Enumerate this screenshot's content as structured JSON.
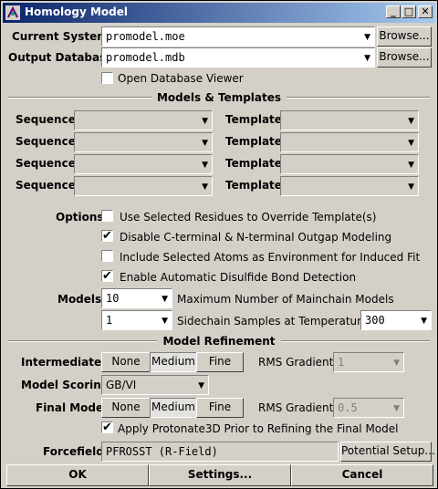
{
  "window": {
    "title": "Homology Model",
    "minimize": "_",
    "maximize": "□",
    "close": "✕"
  },
  "current_system": {
    "label": "Current System:",
    "value": "promodel.moe",
    "browse": "Browse..."
  },
  "output_database": {
    "label": "Output Database:",
    "value": "promodel.mdb",
    "browse": "Browse..."
  },
  "open_viewer": {
    "label": "Open Database Viewer",
    "checked": false
  },
  "models_templates": {
    "title": "Models & Templates",
    "sequence_label": "Sequence:",
    "template_label": "Template:",
    "rows": [
      {
        "sequence": "",
        "template": ""
      },
      {
        "sequence": "",
        "template": ""
      },
      {
        "sequence": "",
        "template": ""
      },
      {
        "sequence": "",
        "template": ""
      }
    ]
  },
  "options": {
    "label": "Options:",
    "items": [
      {
        "label": "Use Selected Residues to Override Template(s)",
        "checked": false
      },
      {
        "label": "Disable C-terminal & N-terminal Outgap Modeling",
        "checked": true
      },
      {
        "label": "Include Selected Atoms as Environment for Induced Fit",
        "checked": false
      },
      {
        "label": "Enable Automatic Disulfide Bond Detection",
        "checked": true
      }
    ]
  },
  "models": {
    "label": "Models:",
    "mainchain_value": "10",
    "mainchain_label": "Maximum Number of Mainchain Models",
    "sidechain_value": "1",
    "sidechain_label": "Sidechain Samples at Temperature",
    "temperature": "300"
  },
  "refinement": {
    "title": "Model Refinement",
    "intermediates": {
      "label": "Intermediates:",
      "options": [
        "None",
        "Medium",
        "Fine"
      ],
      "selected": "Medium",
      "rms_label": "RMS Gradient:",
      "rms_value": "1"
    },
    "scoring": {
      "label": "Model Scoring:",
      "value": "GB/VI"
    },
    "final_model": {
      "label": "Final Model:",
      "options": [
        "None",
        "Medium",
        "Fine"
      ],
      "selected": "Medium",
      "rms_label": "RMS Gradient:",
      "rms_value": "0.5"
    },
    "protonate": {
      "label": "Apply Protonate3D Prior to Refining the Final Model",
      "checked": true
    },
    "forcefield": {
      "label": "Forcefield:",
      "value": "PFROSST (R-Field)",
      "setup": "Potential Setup..."
    }
  },
  "footer": {
    "ok": "OK",
    "settings": "Settings...",
    "cancel": "Cancel"
  }
}
